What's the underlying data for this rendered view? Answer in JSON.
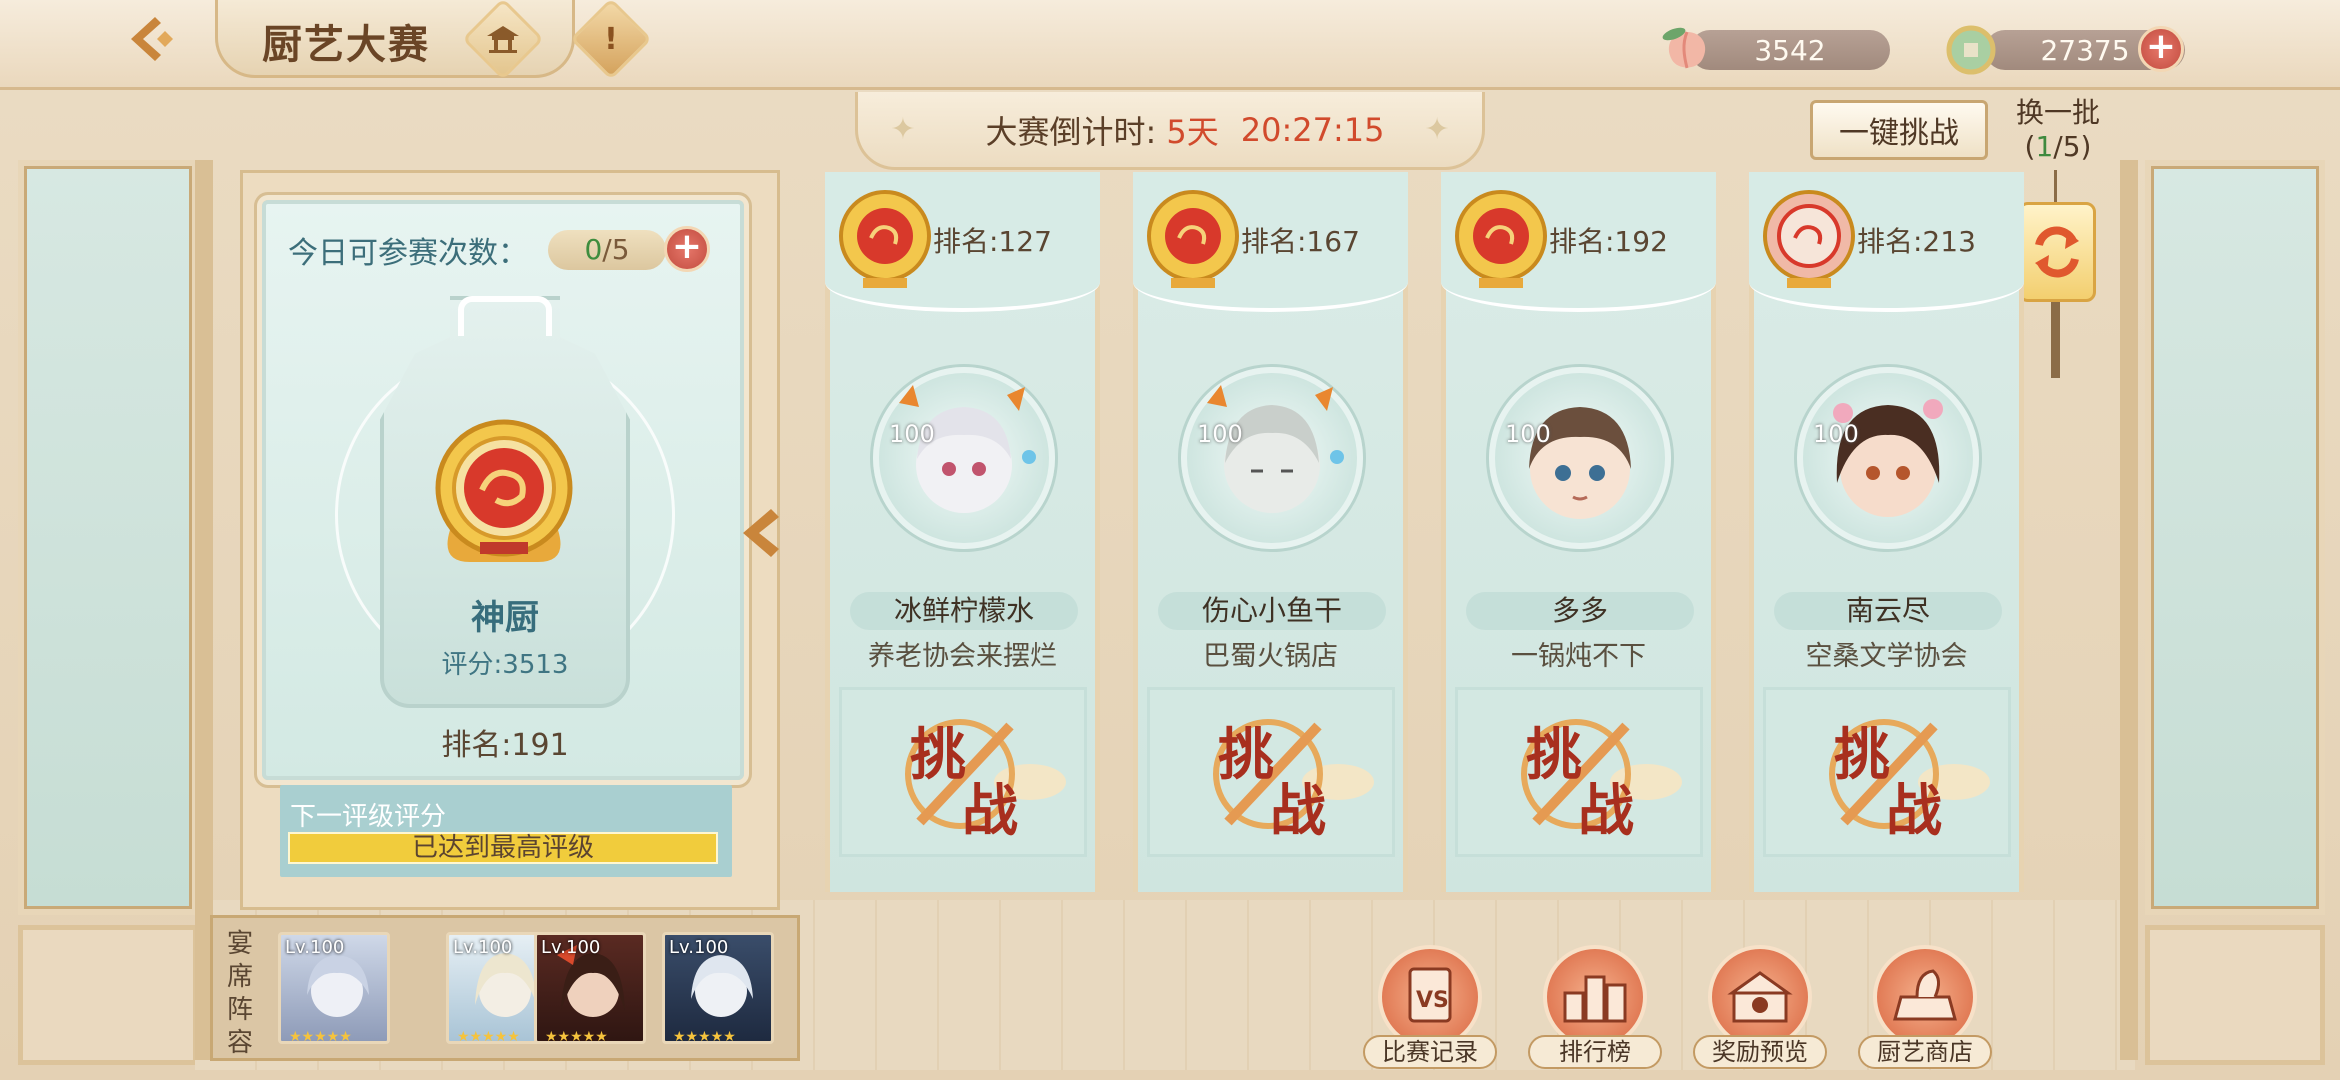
{
  "header": {
    "title": "厨艺大赛",
    "back_icon": "back-arrow-icon",
    "currencies": [
      {
        "icon": "peach-icon",
        "value": "3542"
      },
      {
        "icon": "coin-icon",
        "value": "27375"
      }
    ]
  },
  "countdown": {
    "label": "大赛倒计时:",
    "days": "5天",
    "time": "20:27:15"
  },
  "actions": {
    "one_click_challenge": "一键挑战",
    "swap_batch": "换一批",
    "swap_count_used": "1",
    "swap_count_total": "/5)",
    "swap_count_open": "("
  },
  "player": {
    "attempts_label": "今日可参赛次数：",
    "attempts_used": "0",
    "attempts_total": "/5",
    "rank_title": "神厨",
    "score": "评分:3513",
    "rank": "排名:191",
    "next_label": "下一评级评分",
    "next_status": "已达到最高评级"
  },
  "opponents": [
    {
      "rank": "排名:127",
      "level": "100",
      "name": "冰鲜柠檬水",
      "guild": "养老协会来摆烂",
      "medal": "gold"
    },
    {
      "rank": "排名:167",
      "level": "100",
      "name": "伤心小鱼干",
      "guild": "巴蜀火锅店",
      "medal": "gold"
    },
    {
      "rank": "排名:192",
      "level": "100",
      "name": "多多",
      "guild": "一锅炖不下",
      "medal": "gold"
    },
    {
      "rank": "排名:213",
      "level": "100",
      "name": "南云尽",
      "guild": "空桑文学协会",
      "medal": "red"
    }
  ],
  "challenge": {
    "line1": "挑",
    "line2": "战"
  },
  "lineup": {
    "label": "宴席阵容",
    "heroes": [
      {
        "level": "Lv.100"
      },
      {
        "level": "Lv.100"
      },
      {
        "level": "Lv.100"
      },
      {
        "level": "Lv.100"
      }
    ]
  },
  "menu": [
    {
      "label": "比赛记录",
      "icon": "vs-record-icon"
    },
    {
      "label": "排行榜",
      "icon": "leaderboard-icon"
    },
    {
      "label": "奖励预览",
      "icon": "reward-chest-icon"
    },
    {
      "label": "厨艺商店",
      "icon": "shop-icon"
    }
  ],
  "colors": {
    "accent_red": "#d14a2c",
    "teal_text": "#3c6e7a",
    "progress_yellow": "#f1cc3c"
  }
}
